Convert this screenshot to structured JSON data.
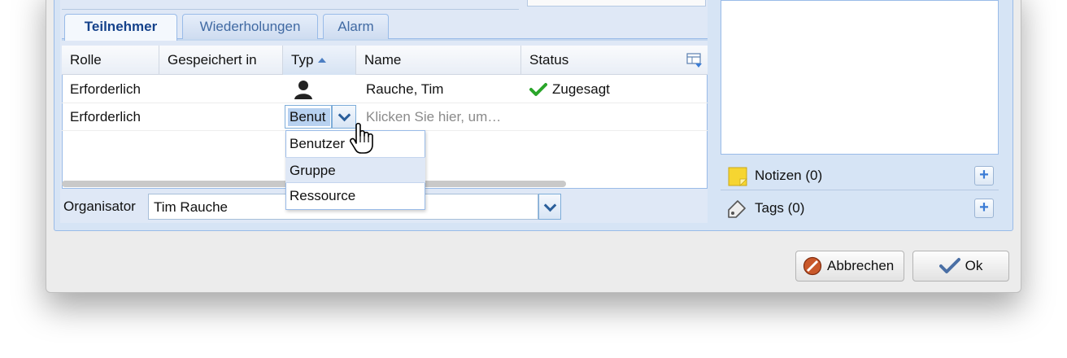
{
  "tabs": [
    {
      "label": "Teilnehmer",
      "active": true
    },
    {
      "label": "Wiederholungen",
      "active": false
    },
    {
      "label": "Alarm",
      "active": false
    }
  ],
  "grid": {
    "columns": [
      "Rolle",
      "Gespeichert in",
      "Typ",
      "Name",
      "Status"
    ],
    "sorted_column": "Typ",
    "rows": [
      {
        "rolle": "Erforderlich",
        "gespeichert": "",
        "typ_icon": "user-icon",
        "name": "Rauche, Tim",
        "status": "Zugesagt",
        "status_icon": "checkmark-icon"
      },
      {
        "rolle": "Erforderlich",
        "gespeichert": "",
        "typ_value": "Benut",
        "name_placeholder": "Klicken Sie hier, um…"
      }
    ]
  },
  "type_dropdown": {
    "options": [
      "Benutzer",
      "Gruppe",
      "Ressource"
    ],
    "highlighted": "Gruppe"
  },
  "organisator": {
    "label": "Organisator",
    "value": "Tim Rauche"
  },
  "sidebar": {
    "notes_label": "Notizen (0)",
    "tags_label": "Tags (0)"
  },
  "footer": {
    "cancel_label": "Abbrechen",
    "ok_label": "Ok"
  },
  "colors": {
    "accent": "#15428b",
    "panel": "#dfe8f6",
    "border": "#99bbe8",
    "check": "#2aa52a",
    "cancel_icon": "#b5481c"
  }
}
